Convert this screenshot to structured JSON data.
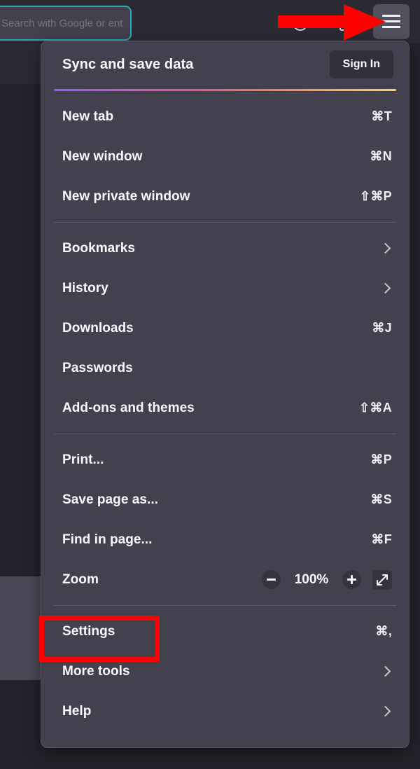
{
  "browser": {
    "urlbar": {
      "value": "",
      "placeholder": "Search with Google or enter address"
    },
    "toolbar_icons": [
      "reload-icon",
      "bookmark-icon"
    ],
    "menu_button": "application-menu-button"
  },
  "panel": {
    "header": {
      "title": "Sync and save data",
      "signin_label": "Sign In"
    },
    "sections": [
      {
        "items": [
          {
            "label": "New tab",
            "shortcut": "⌘T",
            "submenu": false
          },
          {
            "label": "New window",
            "shortcut": "⌘N",
            "submenu": false
          },
          {
            "label": "New private window",
            "shortcut": "⇧⌘P",
            "submenu": false
          }
        ]
      },
      {
        "items": [
          {
            "label": "Bookmarks",
            "shortcut": "",
            "submenu": true
          },
          {
            "label": "History",
            "shortcut": "",
            "submenu": true
          },
          {
            "label": "Downloads",
            "shortcut": "⌘J",
            "submenu": false
          },
          {
            "label": "Passwords",
            "shortcut": "",
            "submenu": false
          },
          {
            "label": "Add-ons and themes",
            "shortcut": "⇧⌘A",
            "submenu": false
          }
        ]
      },
      {
        "items": [
          {
            "label": "Print...",
            "shortcut": "⌘P",
            "submenu": false
          },
          {
            "label": "Save page as...",
            "shortcut": "⌘S",
            "submenu": false
          },
          {
            "label": "Find in page...",
            "shortcut": "⌘F",
            "submenu": false
          }
        ],
        "zoom_row": {
          "label": "Zoom",
          "value": "100%",
          "minus_label": "Zoom out",
          "plus_label": "Zoom in",
          "fullscreen_label": "Enter full screen"
        }
      },
      {
        "items": [
          {
            "label": "Settings",
            "shortcut": "⌘,",
            "submenu": false,
            "highlighted": true
          },
          {
            "label": "More tools",
            "shortcut": "",
            "submenu": true
          },
          {
            "label": "Help",
            "shortcut": "",
            "submenu": true
          }
        ]
      }
    ]
  },
  "annotations": {
    "arrow_color": "#fe0000",
    "box_color": "#fe0000",
    "arrow_target": "application-menu-button",
    "box_target": "Settings"
  },
  "colors": {
    "panel_bg": "#42414d",
    "chrome_bg": "#2b2a33",
    "page_bg": "#23222a",
    "text": "#fbfbfe",
    "urlbar_focus": "#2aa8bd",
    "accent_gradient_start": "#9059ff",
    "accent_gradient_end": "#f2d06b"
  }
}
